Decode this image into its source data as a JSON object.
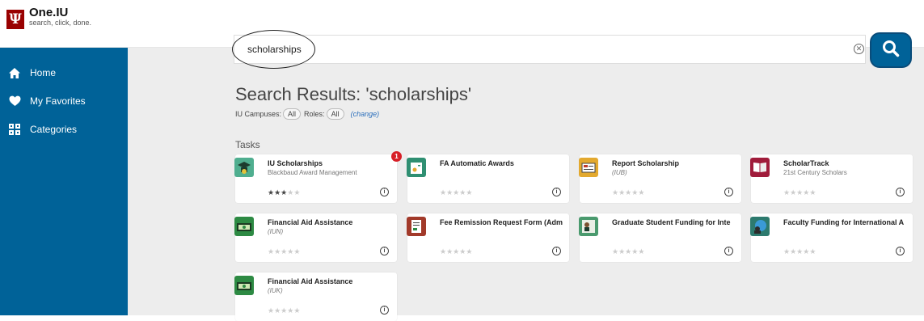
{
  "header": {
    "logo_glyph": "Ψ",
    "app_name": "One.IU",
    "tagline": "search, click, done."
  },
  "sidebar": {
    "items": [
      {
        "label": "Home",
        "icon": "home-icon"
      },
      {
        "label": "My Favorites",
        "icon": "heart-icon"
      },
      {
        "label": "Categories",
        "icon": "grid-icon"
      }
    ]
  },
  "search": {
    "value": "scholarships",
    "clear_glyph": "✕",
    "button_icon": "search-icon"
  },
  "results": {
    "heading": "Search Results: 'scholarships'",
    "campuses_label": "IU Campuses:",
    "campuses_value": "All",
    "roles_label": "Roles:",
    "roles_value": "All",
    "change_label": "(change)"
  },
  "tasks": {
    "section_label": "Tasks",
    "badge_count": "1",
    "cards": [
      {
        "title": "IU Scholarships",
        "sub": "Blackbaud Award Management",
        "rating": 3,
        "tile_color": "#4fae8f",
        "icon": "graduation-cap-icon"
      },
      {
        "title": "FA Automatic Awards",
        "sub": "",
        "rating": 0,
        "tile_color": "#2f8f72",
        "icon": "award-document-icon"
      },
      {
        "title": "Report Scholarship",
        "sub": "(IUB)",
        "rating": 0,
        "tile_color": "#e3a92f",
        "icon": "report-icon"
      },
      {
        "title": "ScholarTrack",
        "sub": "21st Century Scholars",
        "rating": 0,
        "tile_color": "#a01c3b",
        "icon": "book-icon"
      },
      {
        "title": "Financial Aid Assistance",
        "sub": "(IUN)",
        "rating": 0,
        "tile_color": "#2d8a43",
        "icon": "money-icon"
      },
      {
        "title": "Fee Remission Request Form (Adm",
        "sub": "",
        "rating": 0,
        "tile_color": "#a23a2a",
        "icon": "form-icon"
      },
      {
        "title": "Graduate Student Funding for Inte",
        "sub": "",
        "rating": 0,
        "tile_color": "#4a9a6e",
        "icon": "student-icon"
      },
      {
        "title": "Faculty Funding for International A",
        "sub": "",
        "rating": 0,
        "tile_color": "#2d7a6e",
        "icon": "faculty-globe-icon"
      },
      {
        "title": "Financial Aid Assistance",
        "sub": "(IUK)",
        "rating": 0,
        "tile_color": "#2d8a43",
        "icon": "money-icon"
      }
    ]
  },
  "stars": {
    "glyph": "★★★★★"
  },
  "info_glyph": "i"
}
